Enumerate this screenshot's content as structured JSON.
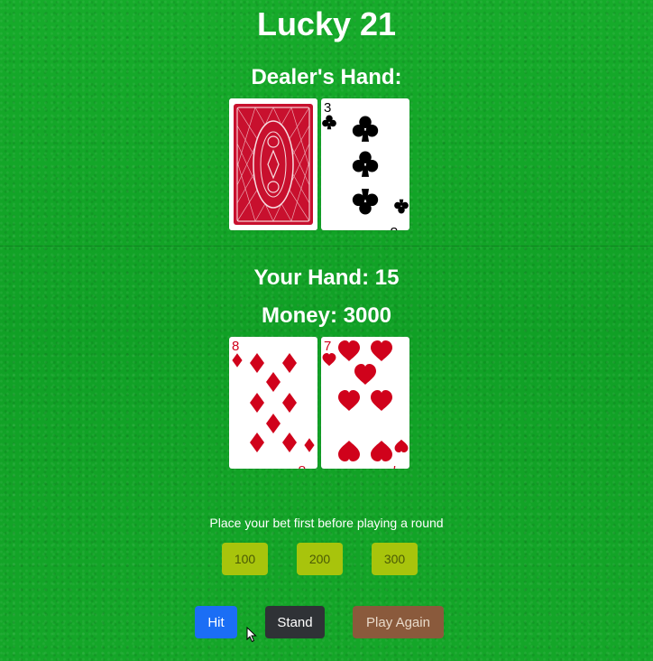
{
  "title": "Lucky 21",
  "dealer": {
    "label": "Dealer's Hand:",
    "cards": [
      {
        "face": "back",
        "color": "#c8102e"
      },
      {
        "rank": "3",
        "suit": "clubs",
        "color": "#000000"
      }
    ]
  },
  "player": {
    "label": "Your Hand: 15",
    "money_label": "Money: 3000",
    "cards": [
      {
        "rank": "8",
        "suit": "diamonds",
        "color": "#d0021b"
      },
      {
        "rank": "7",
        "suit": "hearts",
        "color": "#d0021b"
      }
    ]
  },
  "message": "Place your bet first before playing a round",
  "bets": [
    "100",
    "200",
    "300"
  ],
  "actions": {
    "hit": "Hit",
    "stand": "Stand",
    "play_again": "Play Again"
  },
  "icons": {
    "cursor": "mouse-pointer-icon",
    "club": "club-suit-icon",
    "diamond": "diamond-suit-icon",
    "heart": "heart-suit-icon",
    "card_back": "card-back-icon"
  }
}
